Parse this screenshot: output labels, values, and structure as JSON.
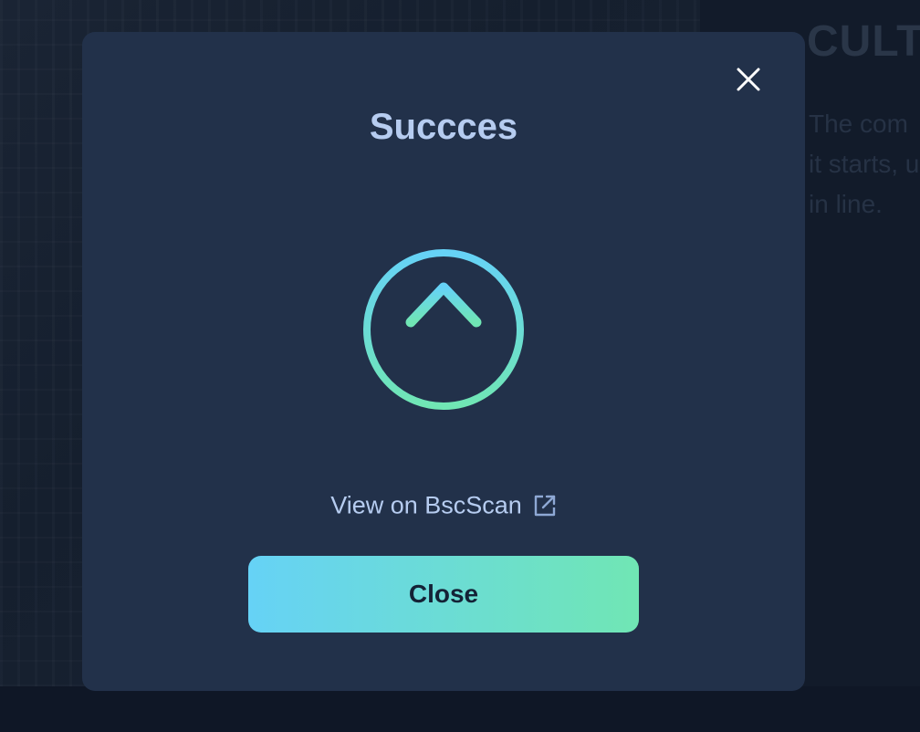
{
  "background": {
    "heading": "CULT",
    "paragraph_lines": [
      "The com",
      "it starts, u",
      "in line."
    ]
  },
  "modal": {
    "title": "Succces",
    "close_icon": "close-icon",
    "status_icon": "upload-arrow-circle-icon",
    "link_label": "View on BscScan",
    "link_icon": "external-link-icon",
    "close_button_label": "Close"
  },
  "colors": {
    "modal_background": "#22314a",
    "page_background": "#111b2b",
    "title_text": "#b6ccf0",
    "gradient_start": "#66d2f6",
    "gradient_end": "#70e6b4"
  }
}
